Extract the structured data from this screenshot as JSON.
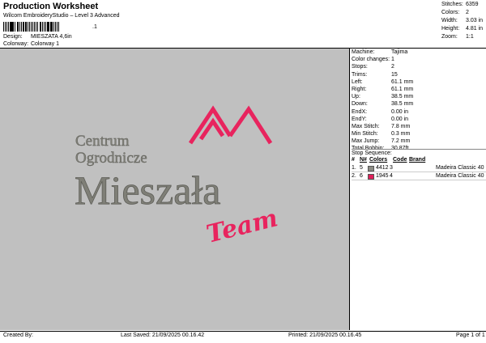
{
  "header": {
    "title": "Production Worksheet",
    "subtitle": "Wilcom EmbroideryStudio – Level 3 Advanced",
    "barcode_text": ".1",
    "design_label": "Design:",
    "design_value": "MIESZATA 4,6in",
    "colorway_label": "Colorway:",
    "colorway_value": "Colorway 1"
  },
  "stats": [
    {
      "label": "Stitches:",
      "value": "6359"
    },
    {
      "label": "Colors:",
      "value": "2"
    },
    {
      "label": "Width:",
      "value": "3.03 in"
    },
    {
      "label": "Height:",
      "value": "4.81 in"
    },
    {
      "label": "Zoom:",
      "value": "1:1"
    }
  ],
  "machine_info": [
    {
      "label": "Machine:",
      "value": "Tajima"
    },
    {
      "label": "Color changes:",
      "value": "1"
    },
    {
      "label": "Stops:",
      "value": "2"
    },
    {
      "label": "Trims:",
      "value": "15"
    },
    {
      "label": "Left:",
      "value": "61.1 mm"
    },
    {
      "label": "Right:",
      "value": "61.1 mm"
    },
    {
      "label": "Up:",
      "value": "38.5 mm"
    },
    {
      "label": "Down:",
      "value": "38.5 mm"
    },
    {
      "label": "EndX:",
      "value": "0.00 in"
    },
    {
      "label": "EndY:",
      "value": "0.00 in"
    },
    {
      "label": "Max Stitch:",
      "value": "7.8 mm"
    },
    {
      "label": "Min Stitch:",
      "value": "0.3 mm"
    },
    {
      "label": "Max Jump:",
      "value": "7.2 mm"
    },
    {
      "label": "Total Bobbin:",
      "value": "30.87ft"
    }
  ],
  "stop_sequence": {
    "title": "Stop Sequence:",
    "headers": [
      "#",
      "N#",
      "Colors",
      "Code",
      "Brand"
    ],
    "rows": [
      {
        "idx": "1.",
        "n": "5",
        "swatch": "#8c8c84",
        "code": "4412",
        "stops": "3",
        "brand": "Madeira Classic 40"
      },
      {
        "idx": "2.",
        "n": "6",
        "swatch": "#e0205a",
        "code": "1945",
        "stops": "4",
        "brand": "Madeira Classic 40"
      }
    ]
  },
  "design": {
    "line1": "Centrum",
    "line2": "Ogrodnicze",
    "main": "Mieszała",
    "script": "Team",
    "gray": "#7f7f77",
    "pink": "#e8245e",
    "background": "#c0c0c0"
  },
  "footer": {
    "created": "Created By:",
    "saved": "Last Saved: 21/09/2025 00.16.42",
    "printed": "Printed: 21/09/2025 00.16.45",
    "page": "Page 1 of 1"
  }
}
